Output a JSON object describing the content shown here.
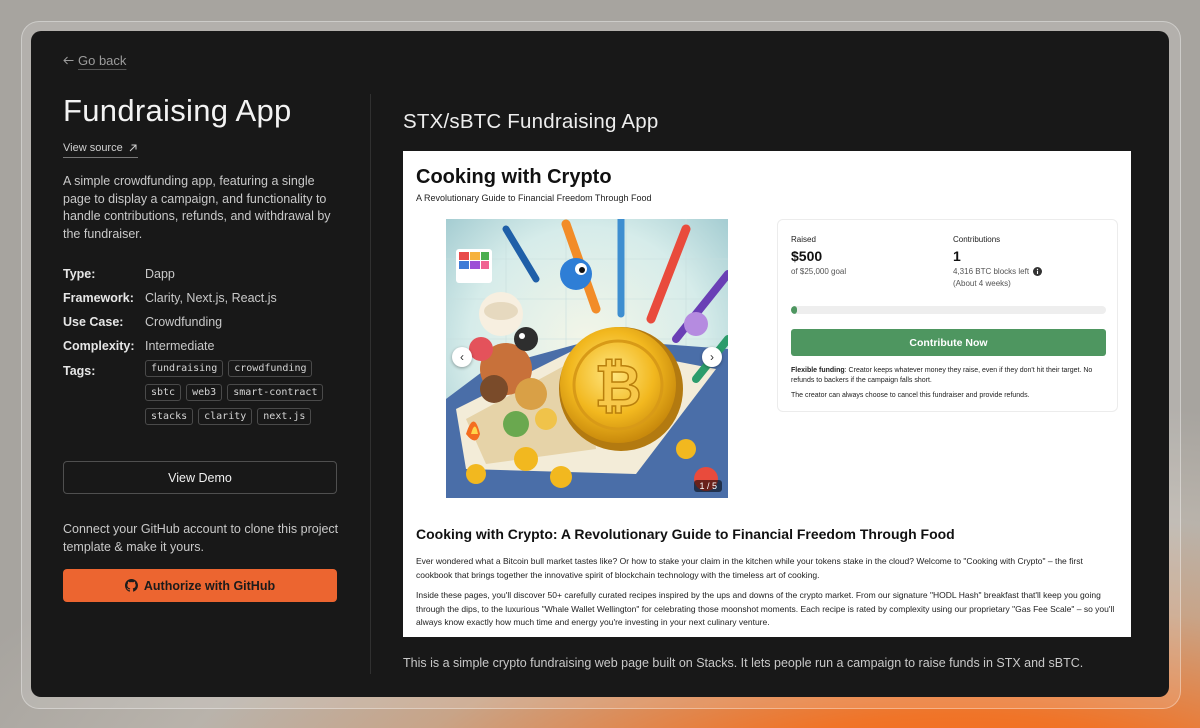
{
  "nav": {
    "back_label": "Go back"
  },
  "project": {
    "title": "Fundraising App",
    "view_source_label": "View source",
    "description": "A simple crowdfunding app, featuring a single page to display a campaign, and functionality to handle contributions, refunds, and withdrawal by the fundraiser.",
    "meta": [
      {
        "key": "Type:",
        "value": "Dapp"
      },
      {
        "key": "Framework:",
        "value": "Clarity, Next.js, React.js"
      },
      {
        "key": "Use Case:",
        "value": "Crowdfunding"
      },
      {
        "key": "Complexity:",
        "value": "Intermediate"
      }
    ],
    "tags_label": "Tags:",
    "tags": [
      "fundraising",
      "crowdfunding",
      "sbtc",
      "web3",
      "smart-contract",
      "stacks",
      "clarity",
      "next.js"
    ],
    "view_demo_label": "View Demo",
    "connect_text": "Connect your GitHub account to clone this project template & make it yours.",
    "authorize_label": "Authorize with GitHub"
  },
  "preview": {
    "heading": "STX/sBTC Fundraising App",
    "caption": "This is a simple crypto fundraising web page built on Stacks. It lets people run a campaign to raise funds in STX and sBTC.",
    "campaign": {
      "title": "Cooking with Crypto",
      "subtitle": "A Revolutionary Guide to Financial Freedom Through Food",
      "carousel": {
        "indicator": "1 / 5",
        "prev_icon": "‹",
        "next_icon": "›"
      },
      "raised_label": "Raised",
      "raised_value": "$500",
      "goal_text": "of $25,000 goal",
      "contributions_label": "Contributions",
      "contributions_value": "1",
      "blocks_left": "4,316 BTC blocks left",
      "time_left": "(About 4 weeks)",
      "progress_fraction": 0.02,
      "contribute_label": "Contribute Now",
      "flexible_label": "Flexible funding",
      "flexible_text": ": Creator keeps whatever money they raise, even if they don't hit their target. No refunds to backers if the campaign falls short.",
      "cancel_text": "The creator can always choose to cancel this fundraiser and provide refunds.",
      "article_title": "Cooking with Crypto: A Revolutionary Guide to Financial Freedom Through Food",
      "paragraphs": [
        "Ever wondered what a Bitcoin bull market tastes like? Or how to stake your claim in the kitchen while your tokens stake in the cloud? Welcome to \"Cooking with Crypto\" – the first cookbook that brings together the innovative spirit of blockchain technology with the timeless art of cooking.",
        "Inside these pages, you'll discover 50+ carefully curated recipes inspired by the ups and downs of the crypto market. From our signature \"HODL Hash\" breakfast that'll keep you going through the dips, to the luxurious \"Whale Wallet Wellington\" for celebrating those moonshot moments. Each recipe is rated by complexity using our proprietary \"Gas Fee Scale\" – so you'll always know exactly how much time and energy you're investing in your next culinary venture."
      ]
    }
  },
  "colors": {
    "accent": "#ec6530",
    "success": "#4e9660",
    "window_bg": "#181818"
  },
  "icons": {
    "back": "arrow-left-icon",
    "external": "external-link-icon",
    "github": "github-icon",
    "info": "info-icon"
  }
}
